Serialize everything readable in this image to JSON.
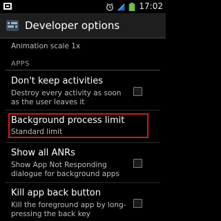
{
  "status_bar": {
    "time": "17:02",
    "icons": [
      "notification-icon",
      "alarm-icon",
      "signal-icon",
      "battery-icon"
    ]
  },
  "action_bar": {
    "title": "Developer options",
    "app_icon": "settings-icon"
  },
  "list": {
    "partial_item": "Animation scale 1x",
    "section_title": "APPS",
    "items": [
      {
        "title": "Don't keep activities",
        "summary_line1": "Destroy every activity as soon",
        "summary_line2": "as the user leaves it",
        "checked": false
      },
      {
        "title": "Background process limit",
        "summary": "Standard limit"
      },
      {
        "title": "Show all ANRs",
        "summary_line1": "Show App Not Responding",
        "summary_line2": "dialogue for background apps",
        "checked": false
      },
      {
        "title": "Kill app back button",
        "summary_line1": "Kill the foreground app by long-",
        "summary_line2": "pressing the back key",
        "checked": false
      }
    ]
  },
  "colors": {
    "highlight": "#d11a1a",
    "actionbar_bg": "#1e1e1e"
  }
}
